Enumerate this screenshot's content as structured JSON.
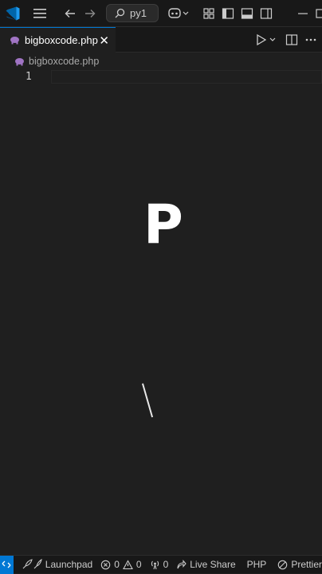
{
  "tab": {
    "filename": "bigboxcode.php"
  },
  "search": {
    "label": "py1"
  },
  "breadcrumb": {
    "file": "bigboxcode.php"
  },
  "editor": {
    "line_number": "1",
    "overlay_letter": "P"
  },
  "status": {
    "launchpad": "Launchpad",
    "errors": "0",
    "warnings": "0",
    "ports": "0",
    "live_share": "Live Share",
    "language": "PHP",
    "prettier": "Prettier"
  },
  "colors": {
    "accent": "#0078d4",
    "php_icon": "#a074c4"
  }
}
